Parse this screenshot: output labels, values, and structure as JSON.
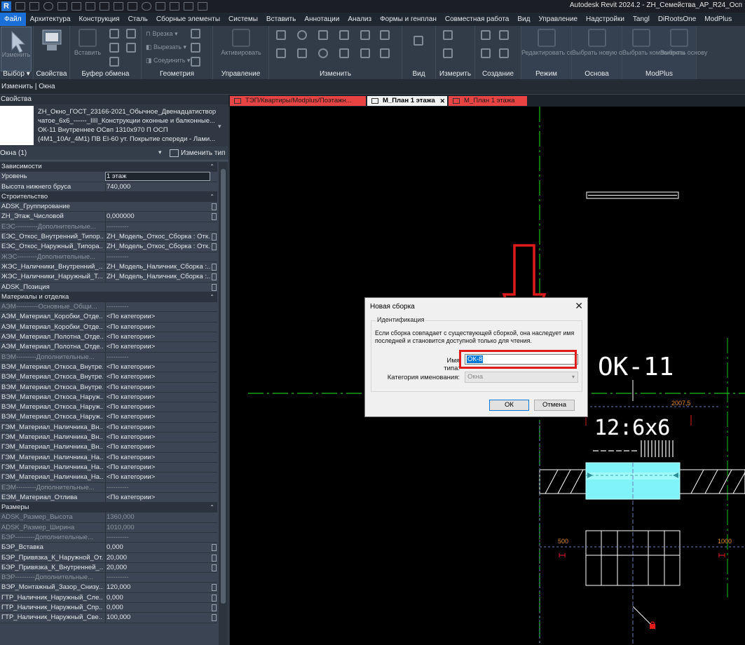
{
  "app": {
    "title": "Autodesk Revit 2024.2 - ZH_Семейства_AP_R24_Осп",
    "logo_letter": "R"
  },
  "menu": {
    "tabs": [
      "Файл",
      "Архитектура",
      "Конструкция",
      "Сталь",
      "Сборные элементы",
      "Системы",
      "Вставить",
      "Аннотации",
      "Анализ",
      "Формы и генплан",
      "Совместная работа",
      "Вид",
      "Управление",
      "Надстройки",
      "Tangl",
      "DiRootsOne",
      "ModPlus"
    ],
    "active_index": 0
  },
  "ribbon": {
    "modify_label": "Изменить",
    "paste_label": "Вставить",
    "cut_label": "Врезка",
    "cut2_label": "Вырезать",
    "join_label": "Соединить",
    "activate_label": "Активировать",
    "edit_family_label": "Редактировать семейство",
    "pick_host_label": "Выбрать новую основу",
    "pick_components_label": "Выбрать компоненты",
    "pick_host2_label": "Выбрать основу",
    "panels": [
      "Выбор",
      "Свойства",
      "Буфер обмена",
      "Геометрия",
      "Управление",
      "Изменить",
      "Вид",
      "Измерить",
      "Создание",
      "Режим",
      "Основа",
      "ModPlus"
    ]
  },
  "context_bar": {
    "text": "Изменить | Окна"
  },
  "properties": {
    "header": "Свойства",
    "type_text": "ZH_Окно_ГОСТ_23166-2021_Обычное_Двенадцатистворчатое_6х6_------_IIII_Конструкции оконные и балконные... ОК-11 Внутреннее ОСвп 1310х970 П ОСП (4М1_10Ar_4М1) ПВ EI-60 ут. Покрытие спереди - Лами...",
    "type_line1": "ZH_Окно_ГОСТ_23166-2021_Обычное_Двенадцатиствор",
    "type_line2": "чатое_6х6_------_IIII_Конструкции оконные и балконные...",
    "type_line3": "ОК-11 Внутреннее ОСвп 1310х970 П ОСП",
    "type_line4": "(4М1_10Ar_4М1) ПВ EI-60 ут.  Покрытие спереди - Лами...",
    "filter": "Окна (1)",
    "edit_type_label": "Изменить тип",
    "rows": [
      {
        "kind": "cat",
        "name": "Зависимости"
      },
      {
        "kind": "p",
        "name": "Уровень",
        "value": "1 этаж",
        "boxed": true
      },
      {
        "kind": "p",
        "name": "Высота нижнего бруса",
        "value": "740,000"
      },
      {
        "kind": "cat",
        "name": "Строительство"
      },
      {
        "kind": "p",
        "name": "ADSK_Группирование",
        "value": "",
        "cb": true
      },
      {
        "kind": "p",
        "name": "ZH_Этаж_Числовой",
        "value": "0,000000",
        "cb": true
      },
      {
        "kind": "dim",
        "name": "ЕЭС----------Дополнительные...",
        "value": "----------"
      },
      {
        "kind": "p",
        "name": "ЕЭС_Откос_Внутренний_Типор...",
        "value": "ZH_Модель_Откос_Сборка : Отк...",
        "cb": true
      },
      {
        "kind": "p",
        "name": "ЕЭС_Откос_Наружный_Типора...",
        "value": "ZH_Модель_Откос_Сборка : Отк...",
        "cb": true
      },
      {
        "kind": "dim",
        "name": "ЖЭС---------Дополнительные...",
        "value": "----------"
      },
      {
        "kind": "p",
        "name": "ЖЭС_Наличники_Внутренний_...",
        "value": "ZH_Модель_Наличник_Сборка :...",
        "cb": true
      },
      {
        "kind": "p",
        "name": "ЖЭС_Наличники_Наружный_Т...",
        "value": "ZH_Модель_Наличник_Сборка :...",
        "cb": true
      },
      {
        "kind": "p",
        "name": "ADSK_Позиция",
        "value": "",
        "cb": true
      },
      {
        "kind": "cat",
        "name": "Материалы и отделка"
      },
      {
        "kind": "dim",
        "name": "АЭМ----------Основные_Общи...",
        "value": "----------"
      },
      {
        "kind": "p",
        "name": "АЭМ_Материал_Коробки_Отде...",
        "value": "<По категории>"
      },
      {
        "kind": "p",
        "name": "АЭМ_Материал_Коробки_Отде...",
        "value": "<По категории>"
      },
      {
        "kind": "p",
        "name": "АЭМ_Материал_Полотна_Отде...",
        "value": "<По категории>"
      },
      {
        "kind": "p",
        "name": "АЭМ_Материал_Полотна_Отде...",
        "value": "<По категории>"
      },
      {
        "kind": "dim",
        "name": "ВЭМ---------Дополнительные...",
        "value": "----------"
      },
      {
        "kind": "p",
        "name": "ВЭМ_Материал_Откоса_Внутре...",
        "value": "<По категории>"
      },
      {
        "kind": "p",
        "name": "ВЭМ_Материал_Откоса_Внутре...",
        "value": "<По категории>"
      },
      {
        "kind": "p",
        "name": "ВЭМ_Материал_Откоса_Внутре...",
        "value": "<По категории>"
      },
      {
        "kind": "p",
        "name": "ВЭМ_Материал_Откоса_Наруж...",
        "value": "<По категории>"
      },
      {
        "kind": "p",
        "name": "ВЭМ_Материал_Откоса_Наруж...",
        "value": "<По категории>"
      },
      {
        "kind": "p",
        "name": "ВЭМ_Материал_Откоса_Наруж...",
        "value": "<По категории>"
      },
      {
        "kind": "p",
        "name": "ГЭМ_Материал_Наличника_Вн...",
        "value": "<По категории>"
      },
      {
        "kind": "p",
        "name": "ГЭМ_Материал_Наличника_Вн...",
        "value": "<По категории>"
      },
      {
        "kind": "p",
        "name": "ГЭМ_Материал_Наличника_Вн...",
        "value": "<По категории>"
      },
      {
        "kind": "p",
        "name": "ГЭМ_Материал_Наличника_На...",
        "value": "<По категории>"
      },
      {
        "kind": "p",
        "name": "ГЭМ_Материал_Наличника_На...",
        "value": "<По категории>"
      },
      {
        "kind": "p",
        "name": "ГЭМ_Материал_Наличника_На...",
        "value": "<По категории>"
      },
      {
        "kind": "dim",
        "name": "ЕЭМ---------Дополнительные...",
        "value": "----------"
      },
      {
        "kind": "p",
        "name": "ЕЭМ_Материал_Отлива",
        "value": "<По категории>"
      },
      {
        "kind": "cat",
        "name": "Размеры"
      },
      {
        "kind": "dim",
        "name": "ADSK_Размер_Высота",
        "value": "1360,000"
      },
      {
        "kind": "dim",
        "name": "ADSK_Размер_Ширина",
        "value": "1010,000"
      },
      {
        "kind": "dim",
        "name": "БЭР---------Дополнительные...",
        "value": "----------"
      },
      {
        "kind": "p",
        "name": "БЭР_Вставка",
        "value": "0,000",
        "cb": true
      },
      {
        "kind": "p",
        "name": "БЭР_Привязка_К_Наружной_От...",
        "value": "20,000",
        "cb": true
      },
      {
        "kind": "p",
        "name": "БЭР_Привязка_К_Внутренней_...",
        "value": "20,000",
        "cb": true
      },
      {
        "kind": "dim",
        "name": "ВЭР---------Дополнительные...",
        "value": "----------"
      },
      {
        "kind": "p",
        "name": "ВЭР_Монтажный_Зазор_Снизу...",
        "value": "120,000",
        "cb": true
      },
      {
        "kind": "p",
        "name": "ГТР_Наличник_Наружный_Сле...",
        "value": "0,000",
        "cb": true
      },
      {
        "kind": "p",
        "name": "ГТР_Наличник_Наружный_Спр...",
        "value": "0,000",
        "cb": true
      },
      {
        "kind": "p",
        "name": "ГТР_Наличник_Наружный_Све...",
        "value": "100,000",
        "cb": true
      }
    ]
  },
  "view_tabs": [
    {
      "label": "ТЭП/Квартиры/Modplus/Поэтажн...",
      "state": "red"
    },
    {
      "label": "М_План 1 этажа",
      "state": "current"
    },
    {
      "label": "М_План 1 этажа",
      "state": "red"
    }
  ],
  "canvas": {
    "tag_label": "ОК-11",
    "window_mark": "12:6х6",
    "dim_top": "2007,5",
    "dim_left": "500",
    "dim_right": "1000",
    "window_color": "#7ff3f7",
    "grid_color": "#16c21b",
    "arrow_color": "#e01b1b"
  },
  "dialog": {
    "title": "Новая сборка",
    "group_title": "Идентификация",
    "info": "Если сборка совпадает с существующей сборкой, она наследует имя последней и становится доступной только для чтения.",
    "name_label": "Имя типа:",
    "name_value": "ОК-8",
    "category_label": "Категория именования:",
    "category_value": "Окна",
    "ok_label": "ОК",
    "cancel_label": "Отмена"
  }
}
